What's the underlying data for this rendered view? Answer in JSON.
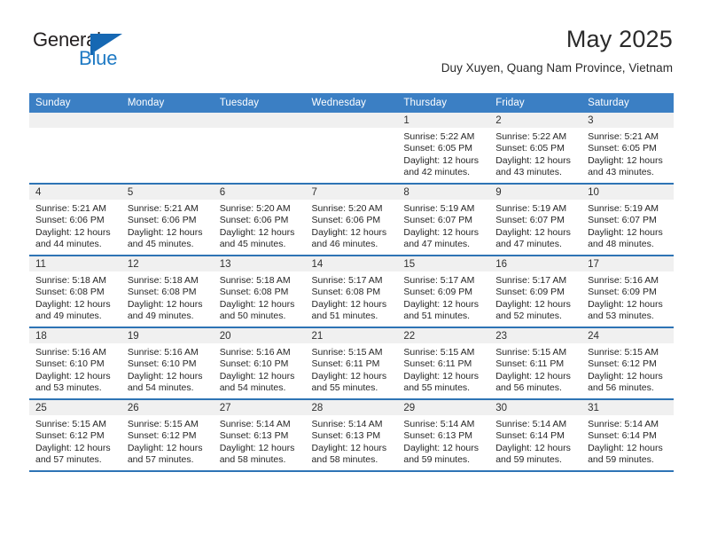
{
  "brand": {
    "line1": "General",
    "line2": "Blue",
    "flag_color": "#1668b3",
    "text_color": "#231f20",
    "blue_text_color": "#1f7ac4"
  },
  "header": {
    "title": "May 2025",
    "subtitle": "Duy Xuyen, Quang Nam Province, Vietnam"
  },
  "theme": {
    "header_row_bg": "#3b7fc4",
    "row_divider": "#2e74b5",
    "daynum_bg": "#f0f0f0"
  },
  "calendar": {
    "weekday_headers": [
      "Sunday",
      "Monday",
      "Tuesday",
      "Wednesday",
      "Thursday",
      "Friday",
      "Saturday"
    ],
    "weeks": [
      [
        {
          "day": "",
          "sunrise": "",
          "sunset": "",
          "daylight_line1": "",
          "daylight_line2": "",
          "empty": true
        },
        {
          "day": "",
          "sunrise": "",
          "sunset": "",
          "daylight_line1": "",
          "daylight_line2": "",
          "empty": true
        },
        {
          "day": "",
          "sunrise": "",
          "sunset": "",
          "daylight_line1": "",
          "daylight_line2": "",
          "empty": true
        },
        {
          "day": "",
          "sunrise": "",
          "sunset": "",
          "daylight_line1": "",
          "daylight_line2": "",
          "empty": true
        },
        {
          "day": "1",
          "sunrise": "Sunrise: 5:22 AM",
          "sunset": "Sunset: 6:05 PM",
          "daylight_line1": "Daylight: 12 hours",
          "daylight_line2": "and 42 minutes.",
          "empty": false
        },
        {
          "day": "2",
          "sunrise": "Sunrise: 5:22 AM",
          "sunset": "Sunset: 6:05 PM",
          "daylight_line1": "Daylight: 12 hours",
          "daylight_line2": "and 43 minutes.",
          "empty": false
        },
        {
          "day": "3",
          "sunrise": "Sunrise: 5:21 AM",
          "sunset": "Sunset: 6:05 PM",
          "daylight_line1": "Daylight: 12 hours",
          "daylight_line2": "and 43 minutes.",
          "empty": false
        }
      ],
      [
        {
          "day": "4",
          "sunrise": "Sunrise: 5:21 AM",
          "sunset": "Sunset: 6:06 PM",
          "daylight_line1": "Daylight: 12 hours",
          "daylight_line2": "and 44 minutes.",
          "empty": false
        },
        {
          "day": "5",
          "sunrise": "Sunrise: 5:21 AM",
          "sunset": "Sunset: 6:06 PM",
          "daylight_line1": "Daylight: 12 hours",
          "daylight_line2": "and 45 minutes.",
          "empty": false
        },
        {
          "day": "6",
          "sunrise": "Sunrise: 5:20 AM",
          "sunset": "Sunset: 6:06 PM",
          "daylight_line1": "Daylight: 12 hours",
          "daylight_line2": "and 45 minutes.",
          "empty": false
        },
        {
          "day": "7",
          "sunrise": "Sunrise: 5:20 AM",
          "sunset": "Sunset: 6:06 PM",
          "daylight_line1": "Daylight: 12 hours",
          "daylight_line2": "and 46 minutes.",
          "empty": false
        },
        {
          "day": "8",
          "sunrise": "Sunrise: 5:19 AM",
          "sunset": "Sunset: 6:07 PM",
          "daylight_line1": "Daylight: 12 hours",
          "daylight_line2": "and 47 minutes.",
          "empty": false
        },
        {
          "day": "9",
          "sunrise": "Sunrise: 5:19 AM",
          "sunset": "Sunset: 6:07 PM",
          "daylight_line1": "Daylight: 12 hours",
          "daylight_line2": "and 47 minutes.",
          "empty": false
        },
        {
          "day": "10",
          "sunrise": "Sunrise: 5:19 AM",
          "sunset": "Sunset: 6:07 PM",
          "daylight_line1": "Daylight: 12 hours",
          "daylight_line2": "and 48 minutes.",
          "empty": false
        }
      ],
      [
        {
          "day": "11",
          "sunrise": "Sunrise: 5:18 AM",
          "sunset": "Sunset: 6:08 PM",
          "daylight_line1": "Daylight: 12 hours",
          "daylight_line2": "and 49 minutes.",
          "empty": false
        },
        {
          "day": "12",
          "sunrise": "Sunrise: 5:18 AM",
          "sunset": "Sunset: 6:08 PM",
          "daylight_line1": "Daylight: 12 hours",
          "daylight_line2": "and 49 minutes.",
          "empty": false
        },
        {
          "day": "13",
          "sunrise": "Sunrise: 5:18 AM",
          "sunset": "Sunset: 6:08 PM",
          "daylight_line1": "Daylight: 12 hours",
          "daylight_line2": "and 50 minutes.",
          "empty": false
        },
        {
          "day": "14",
          "sunrise": "Sunrise: 5:17 AM",
          "sunset": "Sunset: 6:08 PM",
          "daylight_line1": "Daylight: 12 hours",
          "daylight_line2": "and 51 minutes.",
          "empty": false
        },
        {
          "day": "15",
          "sunrise": "Sunrise: 5:17 AM",
          "sunset": "Sunset: 6:09 PM",
          "daylight_line1": "Daylight: 12 hours",
          "daylight_line2": "and 51 minutes.",
          "empty": false
        },
        {
          "day": "16",
          "sunrise": "Sunrise: 5:17 AM",
          "sunset": "Sunset: 6:09 PM",
          "daylight_line1": "Daylight: 12 hours",
          "daylight_line2": "and 52 minutes.",
          "empty": false
        },
        {
          "day": "17",
          "sunrise": "Sunrise: 5:16 AM",
          "sunset": "Sunset: 6:09 PM",
          "daylight_line1": "Daylight: 12 hours",
          "daylight_line2": "and 53 minutes.",
          "empty": false
        }
      ],
      [
        {
          "day": "18",
          "sunrise": "Sunrise: 5:16 AM",
          "sunset": "Sunset: 6:10 PM",
          "daylight_line1": "Daylight: 12 hours",
          "daylight_line2": "and 53 minutes.",
          "empty": false
        },
        {
          "day": "19",
          "sunrise": "Sunrise: 5:16 AM",
          "sunset": "Sunset: 6:10 PM",
          "daylight_line1": "Daylight: 12 hours",
          "daylight_line2": "and 54 minutes.",
          "empty": false
        },
        {
          "day": "20",
          "sunrise": "Sunrise: 5:16 AM",
          "sunset": "Sunset: 6:10 PM",
          "daylight_line1": "Daylight: 12 hours",
          "daylight_line2": "and 54 minutes.",
          "empty": false
        },
        {
          "day": "21",
          "sunrise": "Sunrise: 5:15 AM",
          "sunset": "Sunset: 6:11 PM",
          "daylight_line1": "Daylight: 12 hours",
          "daylight_line2": "and 55 minutes.",
          "empty": false
        },
        {
          "day": "22",
          "sunrise": "Sunrise: 5:15 AM",
          "sunset": "Sunset: 6:11 PM",
          "daylight_line1": "Daylight: 12 hours",
          "daylight_line2": "and 55 minutes.",
          "empty": false
        },
        {
          "day": "23",
          "sunrise": "Sunrise: 5:15 AM",
          "sunset": "Sunset: 6:11 PM",
          "daylight_line1": "Daylight: 12 hours",
          "daylight_line2": "and 56 minutes.",
          "empty": false
        },
        {
          "day": "24",
          "sunrise": "Sunrise: 5:15 AM",
          "sunset": "Sunset: 6:12 PM",
          "daylight_line1": "Daylight: 12 hours",
          "daylight_line2": "and 56 minutes.",
          "empty": false
        }
      ],
      [
        {
          "day": "25",
          "sunrise": "Sunrise: 5:15 AM",
          "sunset": "Sunset: 6:12 PM",
          "daylight_line1": "Daylight: 12 hours",
          "daylight_line2": "and 57 minutes.",
          "empty": false
        },
        {
          "day": "26",
          "sunrise": "Sunrise: 5:15 AM",
          "sunset": "Sunset: 6:12 PM",
          "daylight_line1": "Daylight: 12 hours",
          "daylight_line2": "and 57 minutes.",
          "empty": false
        },
        {
          "day": "27",
          "sunrise": "Sunrise: 5:14 AM",
          "sunset": "Sunset: 6:13 PM",
          "daylight_line1": "Daylight: 12 hours",
          "daylight_line2": "and 58 minutes.",
          "empty": false
        },
        {
          "day": "28",
          "sunrise": "Sunrise: 5:14 AM",
          "sunset": "Sunset: 6:13 PM",
          "daylight_line1": "Daylight: 12 hours",
          "daylight_line2": "and 58 minutes.",
          "empty": false
        },
        {
          "day": "29",
          "sunrise": "Sunrise: 5:14 AM",
          "sunset": "Sunset: 6:13 PM",
          "daylight_line1": "Daylight: 12 hours",
          "daylight_line2": "and 59 minutes.",
          "empty": false
        },
        {
          "day": "30",
          "sunrise": "Sunrise: 5:14 AM",
          "sunset": "Sunset: 6:14 PM",
          "daylight_line1": "Daylight: 12 hours",
          "daylight_line2": "and 59 minutes.",
          "empty": false
        },
        {
          "day": "31",
          "sunrise": "Sunrise: 5:14 AM",
          "sunset": "Sunset: 6:14 PM",
          "daylight_line1": "Daylight: 12 hours",
          "daylight_line2": "and 59 minutes.",
          "empty": false
        }
      ]
    ]
  }
}
